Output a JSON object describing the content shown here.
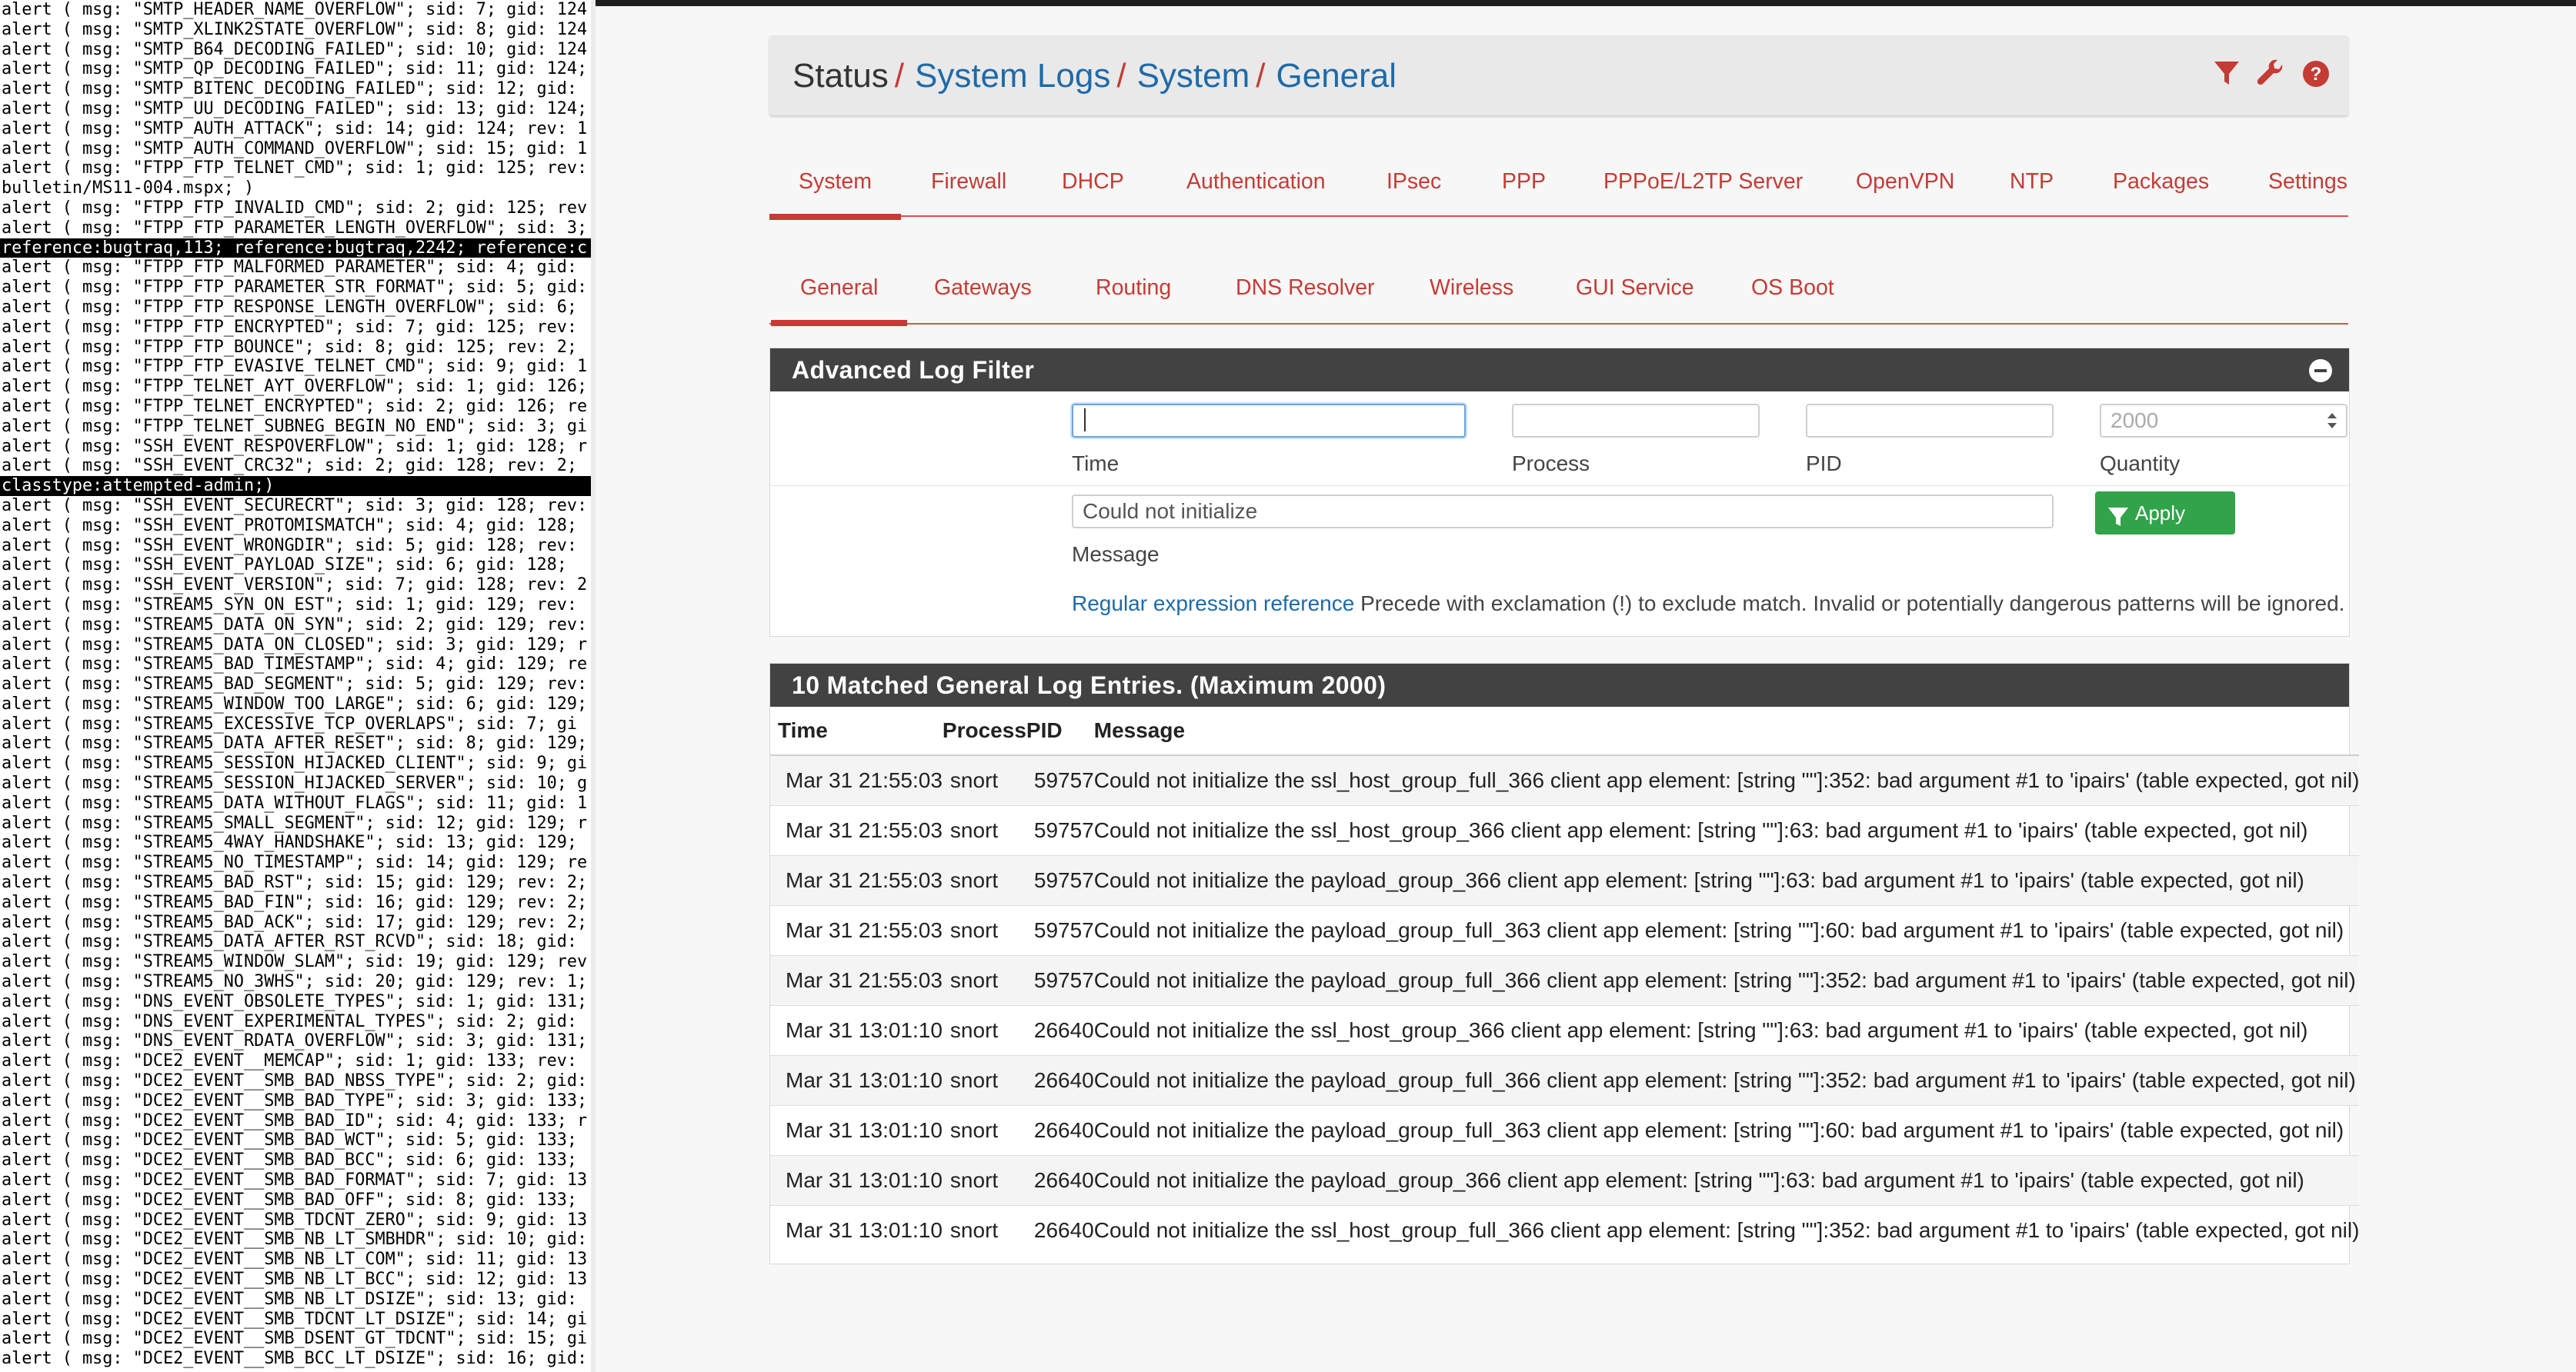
{
  "terminal": {
    "lines": [
      {
        "text": "alert ( msg: \"SMTP_HEADER_NAME_OVERFLOW\"; sid: 7; gid: 124",
        "dark": false
      },
      {
        "text": "alert ( msg: \"SMTP_XLINK2STATE_OVERFLOW\"; sid: 8; gid: 124",
        "dark": false
      },
      {
        "text": "alert ( msg: \"SMTP_B64_DECODING_FAILED\"; sid: 10; gid: 124",
        "dark": false
      },
      {
        "text": "alert ( msg: \"SMTP_QP_DECODING_FAILED\"; sid: 11; gid: 124;",
        "dark": false
      },
      {
        "text": "alert ( msg: \"SMTP_BITENC_DECODING_FAILED\"; sid: 12; gid:",
        "dark": false
      },
      {
        "text": "alert ( msg: \"SMTP_UU_DECODING_FAILED\"; sid: 13; gid: 124;",
        "dark": false
      },
      {
        "text": "alert ( msg: \"SMTP_AUTH_ATTACK\"; sid: 14; gid: 124; rev: 1",
        "dark": false
      },
      {
        "text": "alert ( msg: \"SMTP_AUTH_COMMAND_OVERFLOW\"; sid: 15; gid: 1",
        "dark": false
      },
      {
        "text": "alert ( msg: \"FTPP_FTP_TELNET_CMD\"; sid: 1; gid: 125; rev:",
        "dark": false
      },
      {
        "text": "bulletin/MS11-004.mspx; )",
        "dark": false
      },
      {
        "text": "alert ( msg: \"FTPP_FTP_INVALID_CMD\"; sid: 2; gid: 125; rev",
        "dark": false
      },
      {
        "text": "alert ( msg: \"FTPP_FTP_PARAMETER_LENGTH_OVERFLOW\"; sid: 3;",
        "dark": false
      },
      {
        "text": "reference:bugtraq,113; reference:bugtraq,2242; reference:c",
        "dark": true
      },
      {
        "text": "alert ( msg: \"FTPP_FTP_MALFORMED_PARAMETER\"; sid: 4; gid:",
        "dark": false
      },
      {
        "text": "alert ( msg: \"FTPP_FTP_PARAMETER_STR_FORMAT\"; sid: 5; gid:",
        "dark": false
      },
      {
        "text": "alert ( msg: \"FTPP_FTP_RESPONSE_LENGTH_OVERFLOW\"; sid: 6;",
        "dark": false
      },
      {
        "text": "alert ( msg: \"FTPP_FTP_ENCRYPTED\"; sid: 7; gid: 125; rev:",
        "dark": false
      },
      {
        "text": "alert ( msg: \"FTPP_FTP_BOUNCE\"; sid: 8; gid: 125; rev: 2;",
        "dark": false
      },
      {
        "text": "alert ( msg: \"FTPP_FTP_EVASIVE_TELNET_CMD\"; sid: 9; gid: 1",
        "dark": false
      },
      {
        "text": "alert ( msg: \"FTPP_TELNET_AYT_OVERFLOW\"; sid: 1; gid: 126;",
        "dark": false
      },
      {
        "text": "alert ( msg: \"FTPP_TELNET_ENCRYPTED\"; sid: 2; gid: 126; re",
        "dark": false
      },
      {
        "text": "alert ( msg: \"FTPP_TELNET_SUBNEG_BEGIN_NO_END\"; sid: 3; gi",
        "dark": false
      },
      {
        "text": "alert ( msg: \"SSH_EVENT_RESPOVERFLOW\"; sid: 1; gid: 128; r",
        "dark": false
      },
      {
        "text": "alert ( msg: \"SSH_EVENT_CRC32\"; sid: 2; gid: 128; rev: 2;",
        "dark": false
      },
      {
        "text": "classtype:attempted-admin;)",
        "dark": true
      },
      {
        "text": "alert ( msg: \"SSH_EVENT_SECURECRT\"; sid: 3; gid: 128; rev:",
        "dark": false
      },
      {
        "text": "alert ( msg: \"SSH_EVENT_PROTOMISMATCH\"; sid: 4; gid: 128;",
        "dark": false
      },
      {
        "text": "alert ( msg: \"SSH_EVENT_WRONGDIR\"; sid: 5; gid: 128; rev:",
        "dark": false
      },
      {
        "text": "alert ( msg: \"SSH_EVENT_PAYLOAD_SIZE\"; sid: 6; gid: 128;",
        "dark": false
      },
      {
        "text": "alert ( msg: \"SSH_EVENT_VERSION\"; sid: 7; gid: 128; rev: 2",
        "dark": false
      },
      {
        "text": "alert ( msg: \"STREAM5_SYN_ON_EST\"; sid: 1; gid: 129; rev:",
        "dark": false
      },
      {
        "text": "alert ( msg: \"STREAM5_DATA_ON_SYN\"; sid: 2; gid: 129; rev:",
        "dark": false
      },
      {
        "text": "alert ( msg: \"STREAM5_DATA_ON_CLOSED\"; sid: 3; gid: 129; r",
        "dark": false
      },
      {
        "text": "alert ( msg: \"STREAM5_BAD_TIMESTAMP\"; sid: 4; gid: 129; re",
        "dark": false
      },
      {
        "text": "alert ( msg: \"STREAM5_BAD_SEGMENT\"; sid: 5; gid: 129; rev:",
        "dark": false
      },
      {
        "text": "alert ( msg: \"STREAM5_WINDOW_TOO_LARGE\"; sid: 6; gid: 129;",
        "dark": false
      },
      {
        "text": "alert ( msg: \"STREAM5_EXCESSIVE_TCP_OVERLAPS\"; sid: 7; gi",
        "dark": false
      },
      {
        "text": "alert ( msg: \"STREAM5_DATA_AFTER_RESET\"; sid: 8; gid: 129;",
        "dark": false
      },
      {
        "text": "alert ( msg: \"STREAM5_SESSION_HIJACKED_CLIENT\"; sid: 9; gi",
        "dark": false
      },
      {
        "text": "alert ( msg: \"STREAM5_SESSION_HIJACKED_SERVER\"; sid: 10; g",
        "dark": false
      },
      {
        "text": "alert ( msg: \"STREAM5_DATA_WITHOUT_FLAGS\"; sid: 11; gid: 1",
        "dark": false
      },
      {
        "text": "alert ( msg: \"STREAM5_SMALL_SEGMENT\"; sid: 12; gid: 129; r",
        "dark": false
      },
      {
        "text": "alert ( msg: \"STREAM5_4WAY_HANDSHAKE\"; sid: 13; gid: 129;",
        "dark": false
      },
      {
        "text": "alert ( msg: \"STREAM5_NO_TIMESTAMP\"; sid: 14; gid: 129; re",
        "dark": false
      },
      {
        "text": "alert ( msg: \"STREAM5_BAD_RST\"; sid: 15; gid: 129; rev: 2;",
        "dark": false
      },
      {
        "text": "alert ( msg: \"STREAM5_BAD_FIN\"; sid: 16; gid: 129; rev: 2;",
        "dark": false
      },
      {
        "text": "alert ( msg: \"STREAM5_BAD_ACK\"; sid: 17; gid: 129; rev: 2;",
        "dark": false
      },
      {
        "text": "alert ( msg: \"STREAM5_DATA_AFTER_RST_RCVD\"; sid: 18; gid:",
        "dark": false
      },
      {
        "text": "alert ( msg: \"STREAM5_WINDOW_SLAM\"; sid: 19; gid: 129; rev",
        "dark": false
      },
      {
        "text": "alert ( msg: \"STREAM5_NO_3WHS\"; sid: 20; gid: 129; rev: 1;",
        "dark": false
      },
      {
        "text": "alert ( msg: \"DNS_EVENT_OBSOLETE_TYPES\"; sid: 1; gid: 131;",
        "dark": false
      },
      {
        "text": "alert ( msg: \"DNS_EVENT_EXPERIMENTAL_TYPES\"; sid: 2; gid:",
        "dark": false
      },
      {
        "text": "alert ( msg: \"DNS_EVENT_RDATA_OVERFLOW\"; sid: 3; gid: 131;",
        "dark": false
      },
      {
        "text": "alert ( msg: \"DCE2_EVENT__MEMCAP\"; sid: 1; gid: 133; rev:",
        "dark": false
      },
      {
        "text": "alert ( msg: \"DCE2_EVENT__SMB_BAD_NBSS_TYPE\"; sid: 2; gid:",
        "dark": false
      },
      {
        "text": "alert ( msg: \"DCE2_EVENT__SMB_BAD_TYPE\"; sid: 3; gid: 133;",
        "dark": false
      },
      {
        "text": "alert ( msg: \"DCE2_EVENT__SMB_BAD_ID\"; sid: 4; gid: 133; r",
        "dark": false
      },
      {
        "text": "alert ( msg: \"DCE2_EVENT__SMB_BAD_WCT\"; sid: 5; gid: 133;",
        "dark": false
      },
      {
        "text": "alert ( msg: \"DCE2_EVENT__SMB_BAD_BCC\"; sid: 6; gid: 133;",
        "dark": false
      },
      {
        "text": "alert ( msg: \"DCE2_EVENT__SMB_BAD_FORMAT\"; sid: 7; gid: 13",
        "dark": false
      },
      {
        "text": "alert ( msg: \"DCE2_EVENT__SMB_BAD_OFF\"; sid: 8; gid: 133;",
        "dark": false
      },
      {
        "text": "alert ( msg: \"DCE2_EVENT__SMB_TDCNT_ZERO\"; sid: 9; gid: 13",
        "dark": false
      },
      {
        "text": "alert ( msg: \"DCE2_EVENT__SMB_NB_LT_SMBHDR\"; sid: 10; gid:",
        "dark": false
      },
      {
        "text": "alert ( msg: \"DCE2_EVENT__SMB_NB_LT_COM\"; sid: 11; gid: 13",
        "dark": false
      },
      {
        "text": "alert ( msg: \"DCE2_EVENT__SMB_NB_LT_BCC\"; sid: 12; gid: 13",
        "dark": false
      },
      {
        "text": "alert ( msg: \"DCE2_EVENT__SMB_NB_LT_DSIZE\"; sid: 13; gid:",
        "dark": false
      },
      {
        "text": "alert ( msg: \"DCE2_EVENT__SMB_TDCNT_LT_DSIZE\"; sid: 14; gi",
        "dark": false
      },
      {
        "text": "alert ( msg: \"DCE2_EVENT__SMB_DSENT_GT_TDCNT\"; sid: 15; gi",
        "dark": false
      },
      {
        "text": "alert ( msg: \"DCE2_EVENT__SMB_BCC_LT_DSIZE\"; sid: 16; gid:",
        "dark": false
      }
    ]
  },
  "breadcrumb": {
    "root": "Status",
    "items": [
      "System Logs",
      "System",
      "General"
    ],
    "separator": "/"
  },
  "header_icons": [
    "filter-icon",
    "wrench-icon",
    "help-icon"
  ],
  "tabs_primary": [
    {
      "label": "System",
      "active": true
    },
    {
      "label": "Firewall",
      "active": false
    },
    {
      "label": "DHCP",
      "active": false
    },
    {
      "label": "Authentication",
      "active": false
    },
    {
      "label": "IPsec",
      "active": false
    },
    {
      "label": "PPP",
      "active": false
    },
    {
      "label": "PPPoE/L2TP Server",
      "active": false
    },
    {
      "label": "OpenVPN",
      "active": false
    },
    {
      "label": "NTP",
      "active": false
    },
    {
      "label": "Packages",
      "active": false
    },
    {
      "label": "Settings",
      "active": false
    }
  ],
  "tabs_secondary": [
    {
      "label": "General",
      "active": true
    },
    {
      "label": "Gateways",
      "active": false
    },
    {
      "label": "Routing",
      "active": false
    },
    {
      "label": "DNS Resolver",
      "active": false
    },
    {
      "label": "Wireless",
      "active": false
    },
    {
      "label": "GUI Service",
      "active": false
    },
    {
      "label": "OS Boot",
      "active": false
    }
  ],
  "filter": {
    "title": "Advanced Log Filter",
    "time": {
      "label": "Time",
      "value": ""
    },
    "process": {
      "label": "Process",
      "value": ""
    },
    "pid": {
      "label": "PID",
      "value": ""
    },
    "quantity": {
      "label": "Quantity",
      "placeholder": "2000"
    },
    "message": {
      "label": "Message",
      "value": "Could not initialize"
    },
    "apply_label": "Apply Filter",
    "regex_link": "Regular expression reference",
    "regex_help": " Precede with exclamation (!) to exclude match. Invalid or potentially dangerous patterns will be ignored."
  },
  "results": {
    "title": "10 Matched General Log Entries. (Maximum 2000)",
    "columns": [
      "Time",
      "Process",
      "PID",
      "Message"
    ],
    "rows": [
      {
        "time": "Mar 31 21:55:03",
        "process": "snort",
        "pid": "59757",
        "message": "Could not initialize the ssl_host_group_full_366 client app element: [string \"\"]:352: bad argument #1 to 'ipairs' (table expected, got nil)"
      },
      {
        "time": "Mar 31 21:55:03",
        "process": "snort",
        "pid": "59757",
        "message": "Could not initialize the ssl_host_group_366 client app element: [string \"\"]:63: bad argument #1 to 'ipairs' (table expected, got nil)"
      },
      {
        "time": "Mar 31 21:55:03",
        "process": "snort",
        "pid": "59757",
        "message": "Could not initialize the payload_group_366 client app element: [string \"\"]:63: bad argument #1 to 'ipairs' (table expected, got nil)"
      },
      {
        "time": "Mar 31 21:55:03",
        "process": "snort",
        "pid": "59757",
        "message": "Could not initialize the payload_group_full_363 client app element: [string \"\"]:60: bad argument #1 to 'ipairs' (table expected, got nil)"
      },
      {
        "time": "Mar 31 21:55:03",
        "process": "snort",
        "pid": "59757",
        "message": "Could not initialize the payload_group_full_366 client app element: [string \"\"]:352: bad argument #1 to 'ipairs' (table expected, got nil)"
      },
      {
        "time": "Mar 31 13:01:10",
        "process": "snort",
        "pid": "26640",
        "message": "Could not initialize the ssl_host_group_366 client app element: [string \"\"]:63: bad argument #1 to 'ipairs' (table expected, got nil)"
      },
      {
        "time": "Mar 31 13:01:10",
        "process": "snort",
        "pid": "26640",
        "message": "Could not initialize the payload_group_full_366 client app element: [string \"\"]:352: bad argument #1 to 'ipairs' (table expected, got nil)"
      },
      {
        "time": "Mar 31 13:01:10",
        "process": "snort",
        "pid": "26640",
        "message": "Could not initialize the payload_group_full_363 client app element: [string \"\"]:60: bad argument #1 to 'ipairs' (table expected, got nil)"
      },
      {
        "time": "Mar 31 13:01:10",
        "process": "snort",
        "pid": "26640",
        "message": "Could not initialize the payload_group_366 client app element: [string \"\"]:63: bad argument #1 to 'ipairs' (table expected, got nil)"
      },
      {
        "time": "Mar 31 13:01:10",
        "process": "snort",
        "pid": "26640",
        "message": "Could not initialize the ssl_host_group_full_366 client app element: [string \"\"]:352: bad argument #1 to 'ipairs' (table expected, got nil)"
      }
    ]
  },
  "colors": {
    "link": "#1e6aa8",
    "tab_accent": "#c43c35",
    "panel_header": "#424242",
    "apply_button": "#31a34a"
  }
}
